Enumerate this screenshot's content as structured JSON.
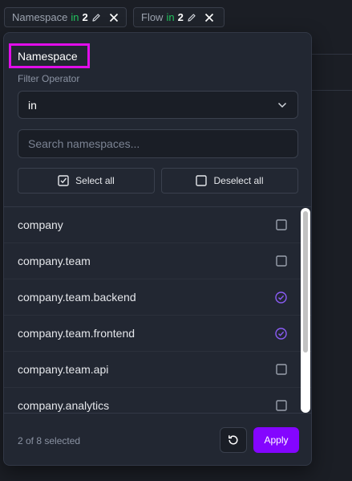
{
  "filter_chips": [
    {
      "field": "Namespace",
      "operator": "in",
      "count": "2"
    },
    {
      "field": "Flow",
      "operator": "in",
      "count": "2"
    }
  ],
  "popover": {
    "title": "Namespace",
    "operator_label": "Filter Operator",
    "operator_value": "in",
    "search_placeholder": "Search namespaces...",
    "select_all": "Select all",
    "deselect_all": "Deselect all",
    "items": [
      {
        "label": "company",
        "checked": false
      },
      {
        "label": "company.team",
        "checked": false
      },
      {
        "label": "company.team.backend",
        "checked": true
      },
      {
        "label": "company.team.frontend",
        "checked": true
      },
      {
        "label": "company.team.api",
        "checked": false
      },
      {
        "label": "company.analytics",
        "checked": false
      }
    ],
    "selected_count": "2 of 8 selected",
    "apply": "Apply"
  },
  "colors": {
    "accent": "#8405ff",
    "check": "#8b5cf6",
    "operator_green": "#22c55e",
    "highlight": "#e10dea"
  },
  "icons": [
    "pencil-icon",
    "close-icon",
    "chevron-down-icon",
    "checkbox-checked-icon",
    "checkbox-empty-icon",
    "circle-check-icon",
    "reset-icon"
  ]
}
